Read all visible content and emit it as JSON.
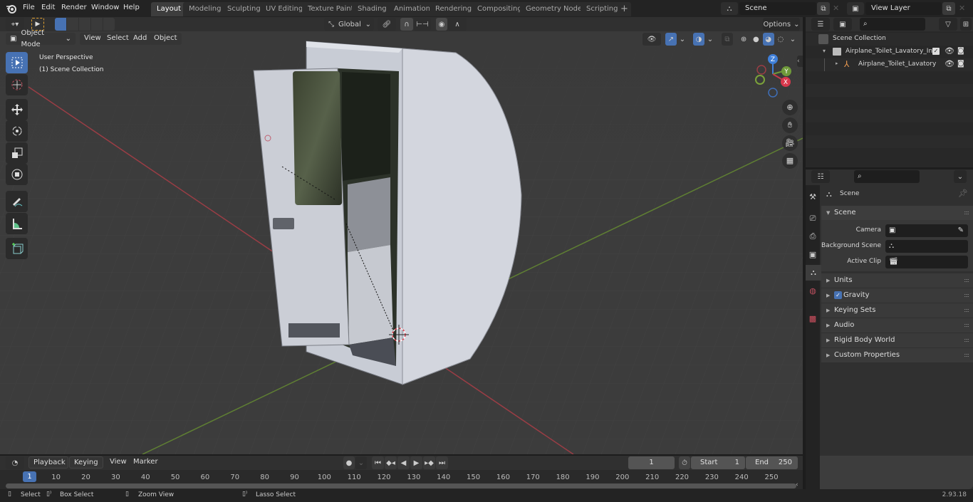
{
  "topbar": {
    "menus": [
      "File",
      "Edit",
      "Render",
      "Window",
      "Help"
    ],
    "workspace_tabs": [
      "Layout",
      "Modeling",
      "Sculpting",
      "UV Editing",
      "Texture Paint",
      "Shading",
      "Animation",
      "Rendering",
      "Compositing",
      "Geometry Nodes",
      "Scripting"
    ],
    "active_tab": "Layout",
    "add_tab": "+",
    "scene_name": "Scene",
    "view_layer_name": "View Layer"
  },
  "viewport_header": {
    "mode": "Object Mode",
    "menus": [
      "View",
      "Select",
      "Add",
      "Object"
    ],
    "orientation": "Global",
    "options_label": "Options"
  },
  "viewport": {
    "overlay_line1": "User Perspective",
    "overlay_line2": "(1) Scene Collection",
    "gizmo": {
      "z": "Z",
      "y": "Y",
      "x": "X"
    },
    "colors": {
      "x_axis": "#b5434f",
      "y_axis": "#6f9a3a",
      "z_axis": "#3f7fd8",
      "active": "#4772b3"
    }
  },
  "toolbar": {
    "tools": [
      "select-box",
      "cursor",
      "move",
      "rotate",
      "scale",
      "transform",
      "annotate",
      "measure",
      "add-cube"
    ]
  },
  "outliner": {
    "search_placeholder": "",
    "root": "Scene Collection",
    "items": [
      {
        "label": "Airplane_Toilet_Lavatory_Inte",
        "type": "collection",
        "checked": true
      },
      {
        "label": "Airplane_Toilet_Lavatory",
        "type": "empty"
      }
    ]
  },
  "properties": {
    "context_title": "Scene",
    "section": "Scene",
    "fields": [
      {
        "label": "Camera",
        "value": ""
      },
      {
        "label": "Background Scene",
        "value": ""
      },
      {
        "label": "Active Clip",
        "value": ""
      }
    ],
    "panels": [
      {
        "label": "Units"
      },
      {
        "label": "Gravity",
        "checkbox": true,
        "checked": true
      },
      {
        "label": "Keying Sets"
      },
      {
        "label": "Audio"
      },
      {
        "label": "Rigid Body World"
      },
      {
        "label": "Custom Properties"
      }
    ]
  },
  "timeline": {
    "menus": [
      "Playback",
      "Keying",
      "View",
      "Marker"
    ],
    "current_frame": "1",
    "start_label": "Start",
    "start": "1",
    "end_label": "End",
    "end": "250",
    "playhead": "1",
    "ticks": [
      "10",
      "20",
      "30",
      "40",
      "50",
      "60",
      "70",
      "80",
      "90",
      "100",
      "110",
      "120",
      "130",
      "140",
      "150",
      "160",
      "170",
      "180",
      "190",
      "200",
      "210",
      "220",
      "230",
      "240",
      "250"
    ]
  },
  "statusbar": {
    "hints": [
      "Select",
      "Box Select",
      "Zoom View",
      "Lasso Select"
    ],
    "version": "2.93.18"
  }
}
